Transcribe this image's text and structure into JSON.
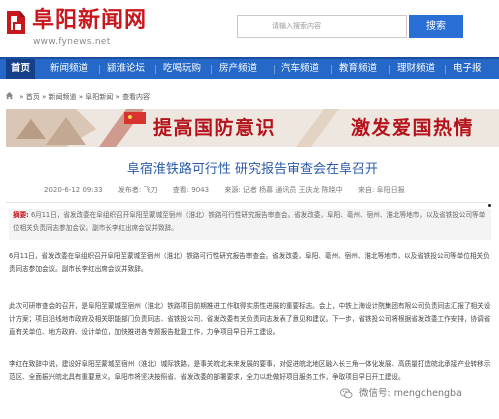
{
  "site": {
    "name": "阜阳新闻网",
    "url": "www.fynews.net",
    "brand_color": "#c9171e"
  },
  "search": {
    "placeholder": "请输入搜索内容",
    "button_label": "搜索",
    "button_color": "#2a6fd6"
  },
  "nav": {
    "bar_color": "#2568c7",
    "items": [
      {
        "label": "首页",
        "active": true
      },
      {
        "label": "新闻频道",
        "active": false
      },
      {
        "label": "颍淮论坛",
        "active": false
      },
      {
        "label": "吃喝玩购",
        "active": false
      },
      {
        "label": "房产频道",
        "active": false
      },
      {
        "label": "汽车频道",
        "active": false
      },
      {
        "label": "教育频道",
        "active": false
      },
      {
        "label": "理财频道",
        "active": false
      },
      {
        "label": "电子报",
        "active": false
      }
    ]
  },
  "breadcrumb": {
    "icon": "home-icon",
    "items": [
      "首页",
      "新闻频道",
      "阜阳新闻",
      "查看内容"
    ],
    "separator": "»"
  },
  "banner": {
    "text_left": "提高国防意识",
    "text_right": "激发爱国热情"
  },
  "article": {
    "title": "阜宿淮铁路可行性 研究报告审查会在阜召开",
    "meta": {
      "date": "2020-6-12 09:33",
      "publisher": "发布者: 飞刀",
      "views": "查看: 9043",
      "source": "来源: 记者 杨慕 通讯员 王庆龙 陈晓中",
      "origin": "来自: 阜阳日报"
    },
    "abstract_label": "摘要:",
    "abstract": "6月11日，省发改委在阜组织召开阜阳至蒙城至宿州（淮北）铁路可行性研究报告审查会。省发改委，阜阳、亳州、宿州、淮北等地市，以及省铁投公司等单位相关负责同志参加会议。副市长李红出席会议并致辞。",
    "paragraphs": [
      "6月11日，省发改委在阜组织召开阜阳至蒙城至宿州（淮北）铁路可行性研究报告审查会。省发改委，阜阳、亳州、宿州、淮北等地市，以及省铁投公司等单位相关负责同志参加会议。副市长李红出席会议并致辞。",
      "此次可研审查会的召开，是阜阳至蒙城至宿州（淮北）铁路项目前期推进工作取得实质性进展的重要标志。会上，中铁上海设计院集团有限公司负责同志汇报了相关设计方案；项目沿线地市政府及相关职能部门负责同志、省铁投公司、省发改委有关负责同志发表了意见和建议。下一步，省铁投公司将根据省发改委工作安排，协调省直有关单位、地方政府、设计单位，加快推进各专题报告批复工作，力争项目早日开工建设。",
      "李红在致辞中说，建设好阜阳至蒙城至宿州（淮北）城际铁路，是事关皖北未来发展的要事，对促进皖北地区融入长三角一体化发展、高质量打造皖北承接产业转移示范区、全面振兴皖北具有重要意义。阜阳市将坚决按照省、省发改委的部署要求，全力以赴做好项目服务工作，争取项目早日开工建设。"
    ]
  },
  "watermark": {
    "icon": "wechat-icon",
    "text": "微信号: mengchengba"
  }
}
